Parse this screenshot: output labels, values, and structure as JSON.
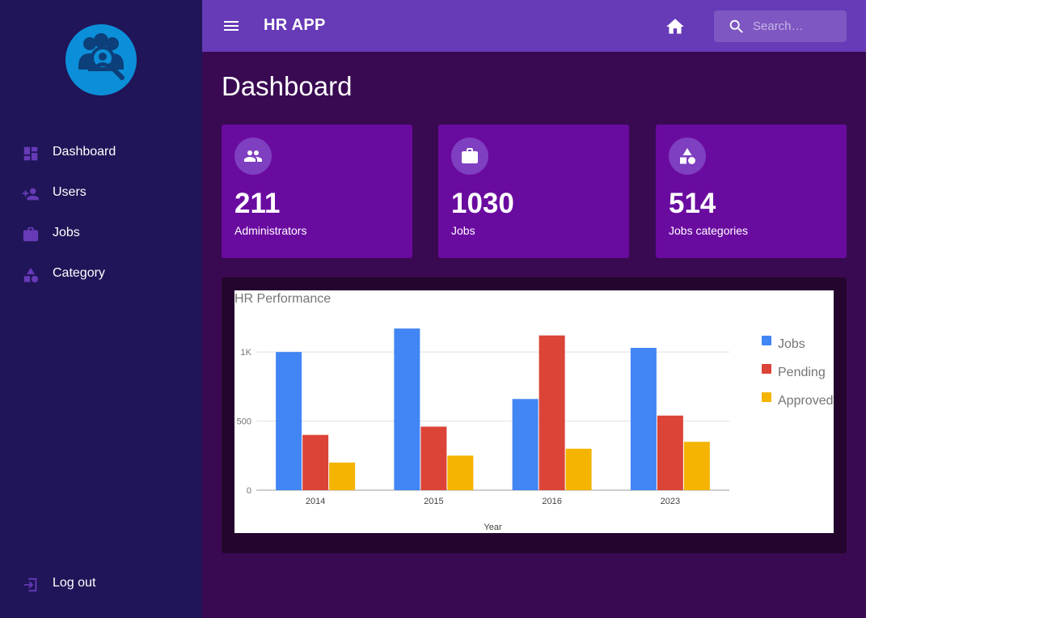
{
  "app": {
    "title": "HR APP",
    "search_placeholder": "Search…"
  },
  "sidebar": {
    "items": [
      {
        "label": "Dashboard",
        "icon": "dashboard-icon"
      },
      {
        "label": "Users",
        "icon": "add-user-icon"
      },
      {
        "label": "Jobs",
        "icon": "briefcase-icon"
      },
      {
        "label": "Category",
        "icon": "category-icon"
      }
    ],
    "logout_label": "Log out"
  },
  "page": {
    "title": "Dashboard"
  },
  "cards": [
    {
      "value": "211",
      "label": "Administrators",
      "icon": "people-icon"
    },
    {
      "value": "1030",
      "label": "Jobs",
      "icon": "briefcase-icon"
    },
    {
      "value": "514",
      "label": "Jobs categories",
      "icon": "category-icon"
    }
  ],
  "colors": {
    "sidebar_bg": "#201558",
    "topbar_bg": "#673ab7",
    "main_bg": "#390a52",
    "card_bg": "#6a0ba0",
    "nav_icon": "#673ab7"
  },
  "chart_data": {
    "type": "bar",
    "title": "HR Performance",
    "xlabel": "Year",
    "ylabel": "",
    "categories": [
      "2014",
      "2015",
      "2016",
      "2023"
    ],
    "series": [
      {
        "name": "Jobs",
        "color": "#4285f4",
        "values": [
          1000,
          1170,
          660,
          1030
        ]
      },
      {
        "name": "Pending",
        "color": "#db4437",
        "values": [
          400,
          460,
          1120,
          540
        ]
      },
      {
        "name": "Approved",
        "color": "#f4b400",
        "values": [
          200,
          250,
          300,
          350
        ]
      }
    ],
    "ylim": [
      0,
      1200
    ],
    "yticks": [
      {
        "value": 0,
        "label": "0"
      },
      {
        "value": 500,
        "label": "500"
      },
      {
        "value": 1000,
        "label": "1K"
      }
    ],
    "grid": true,
    "legend": "right"
  }
}
